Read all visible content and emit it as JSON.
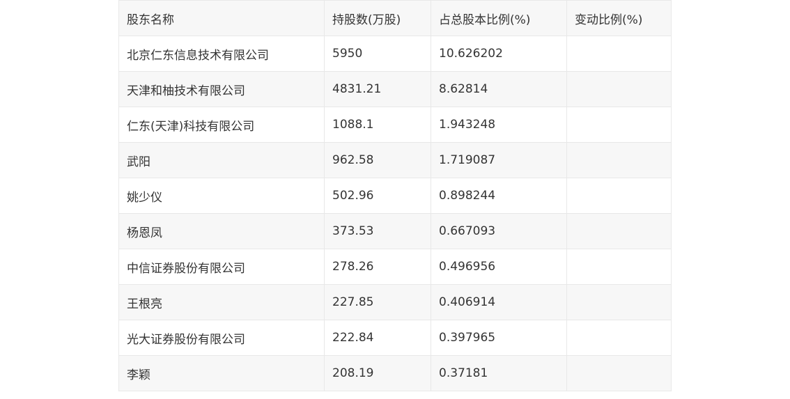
{
  "table": {
    "headers": [
      "股东名称",
      "持股数(万股)",
      "占总股本比例(%)",
      "变动比例(%)"
    ],
    "rows": [
      [
        "北京仁东信息技术有限公司",
        "5950",
        "10.626202",
        ""
      ],
      [
        "天津和柚技术有限公司",
        "4831.21",
        "8.62814",
        ""
      ],
      [
        "仁东(天津)科技有限公司",
        "1088.1",
        "1.943248",
        ""
      ],
      [
        "武阳",
        "962.58",
        "1.719087",
        ""
      ],
      [
        "姚少仪",
        "502.96",
        "0.898244",
        ""
      ],
      [
        "杨恩凤",
        "373.53",
        "0.667093",
        ""
      ],
      [
        "中信证券股份有限公司",
        "278.26",
        "0.496956",
        ""
      ],
      [
        "王根亮",
        "227.85",
        "0.406914",
        ""
      ],
      [
        "光大证券股份有限公司",
        "222.84",
        "0.397965",
        ""
      ],
      [
        "李颖",
        "208.19",
        "0.37181",
        ""
      ]
    ]
  }
}
